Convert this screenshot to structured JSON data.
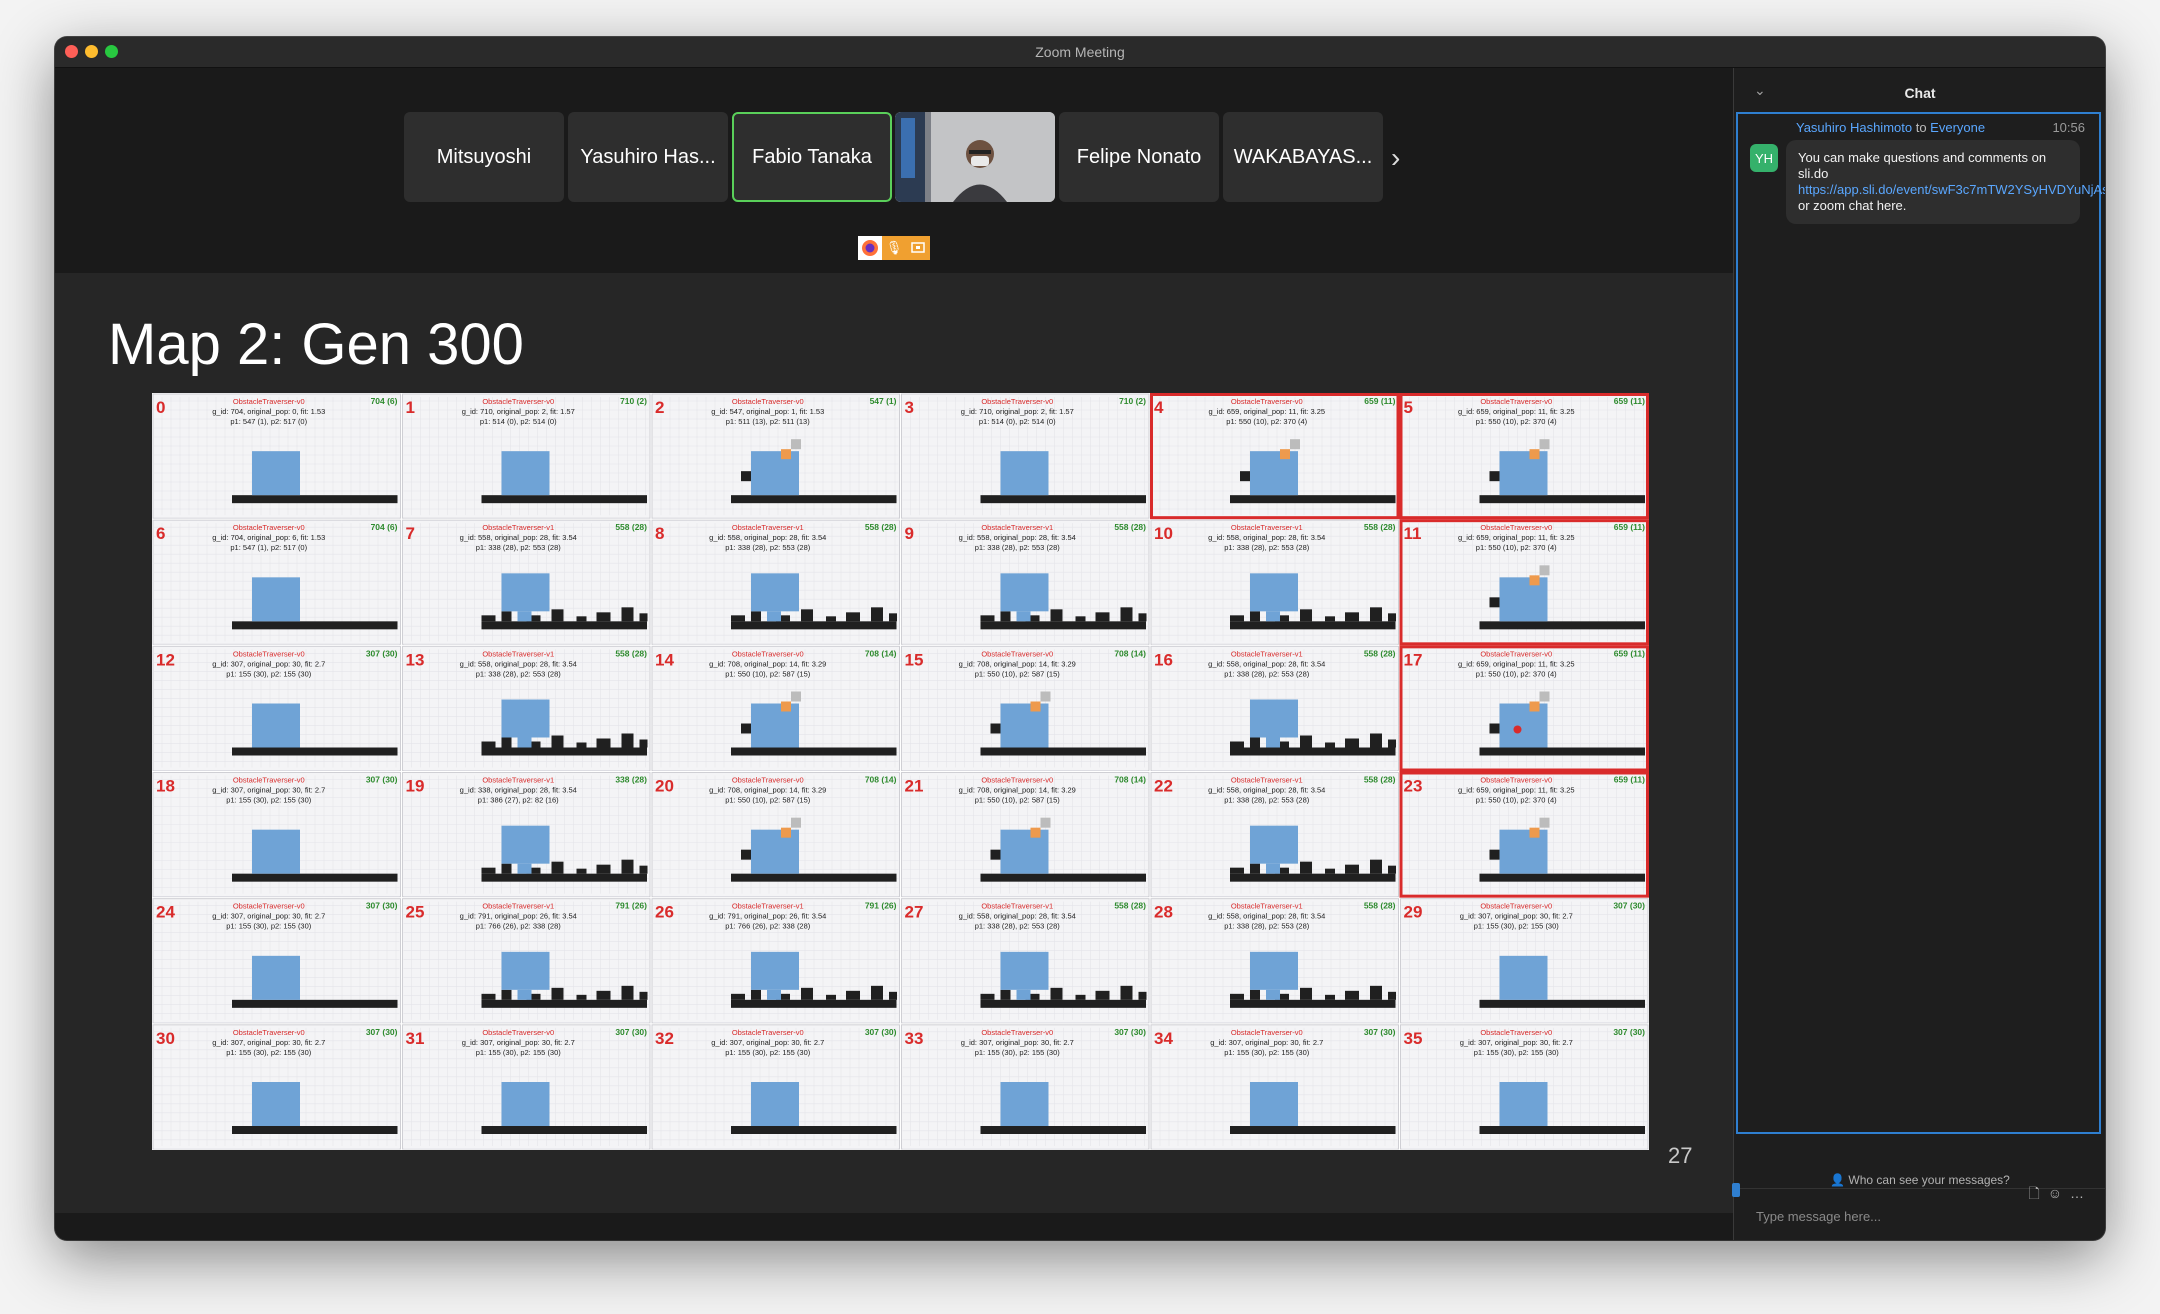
{
  "window": {
    "title": "Zoom Meeting"
  },
  "participants": [
    {
      "name": "Mitsuyoshi"
    },
    {
      "name": "Yasuhiro Has..."
    },
    {
      "name": "Fabio Tanaka",
      "active": true
    },
    {
      "name": "",
      "video": true
    },
    {
      "name": "Felipe Nonato"
    },
    {
      "name": "WAKABAYAS..."
    }
  ],
  "slide": {
    "title": "Map 2: Gen 300",
    "page_number": "27"
  },
  "grid": {
    "env_names": [
      "ObstacleTraverser-v0",
      "ObstacleTraverser-v1"
    ],
    "highlight_color": "#d92b2b",
    "highlighted_cells": [
      4,
      5,
      11,
      17,
      23
    ],
    "cells": [
      {
        "n": "0",
        "env": 0,
        "tr": "704 (6)",
        "l1": "g_id: 704, original_pop: 0, fit: 1.53",
        "l2": "p1: 547 (1), p2: 517 (0)",
        "h": false
      },
      {
        "n": "1",
        "env": 0,
        "tr": "710 (2)",
        "l1": "g_id: 710, original_pop: 2, fit: 1.57",
        "l2": "p1: 514 (0), p2: 514 (0)",
        "h": false
      },
      {
        "n": "2",
        "env": 0,
        "tr": "547 (1)",
        "l1": "g_id: 547, original_pop: 1, fit: 1.53",
        "l2": "p1: 511 (13), p2: 511 (13)",
        "h": false
      },
      {
        "n": "3",
        "env": 0,
        "tr": "710 (2)",
        "l1": "g_id: 710, original_pop: 2, fit: 1.57",
        "l2": "p1: 514 (0), p2: 514 (0)",
        "h": false
      },
      {
        "n": "4",
        "env": 0,
        "tr": "659 (11)",
        "l1": "g_id: 659, original_pop: 11, fit: 3.25",
        "l2": "p1: 550 (10), p2: 370 (4)",
        "h": false
      },
      {
        "n": "5",
        "env": 0,
        "tr": "659 (11)",
        "l1": "g_id: 659, original_pop: 11, fit: 3.25",
        "l2": "p1: 550 (10), p2: 370 (4)",
        "h": false
      },
      {
        "n": "6",
        "env": 0,
        "tr": "704 (6)",
        "l1": "g_id: 704, original_pop: 6, fit: 1.53",
        "l2": "p1: 547 (1), p2: 517 (0)",
        "h": false
      },
      {
        "n": "7",
        "env": 1,
        "tr": "558 (28)",
        "l1": "g_id: 558, original_pop: 28, fit: 3.54",
        "l2": "p1: 338 (28), p2: 553 (28)",
        "h": true
      },
      {
        "n": "8",
        "env": 1,
        "tr": "558 (28)",
        "l1": "g_id: 558, original_pop: 28, fit: 3.54",
        "l2": "p1: 338 (28), p2: 553 (28)",
        "h": true
      },
      {
        "n": "9",
        "env": 1,
        "tr": "558 (28)",
        "l1": "g_id: 558, original_pop: 28, fit: 3.54",
        "l2": "p1: 338 (28), p2: 553 (28)",
        "h": true
      },
      {
        "n": "10",
        "env": 1,
        "tr": "558 (28)",
        "l1": "g_id: 558, original_pop: 28, fit: 3.54",
        "l2": "p1: 338 (28), p2: 553 (28)",
        "h": true
      },
      {
        "n": "11",
        "env": 0,
        "tr": "659 (11)",
        "l1": "g_id: 659, original_pop: 11, fit: 3.25",
        "l2": "p1: 550 (10), p2: 370 (4)",
        "h": false
      },
      {
        "n": "12",
        "env": 0,
        "tr": "307 (30)",
        "l1": "g_id: 307, original_pop: 30, fit: 2.7",
        "l2": "p1: 155 (30), p2: 155 (30)",
        "h": false
      },
      {
        "n": "13",
        "env": 1,
        "tr": "558 (28)",
        "l1": "g_id: 558, original_pop: 28, fit: 3.54",
        "l2": "p1: 338 (28), p2: 553 (28)",
        "h": true
      },
      {
        "n": "14",
        "env": 0,
        "tr": "708 (14)",
        "l1": "g_id: 708, original_pop: 14, fit: 3.29",
        "l2": "p1: 550 (10), p2: 587 (15)",
        "h": false
      },
      {
        "n": "15",
        "env": 0,
        "tr": "708 (14)",
        "l1": "g_id: 708, original_pop: 14, fit: 3.29",
        "l2": "p1: 550 (10), p2: 587 (15)",
        "h": false
      },
      {
        "n": "16",
        "env": 1,
        "tr": "558 (28)",
        "l1": "g_id: 558, original_pop: 28, fit: 3.54",
        "l2": "p1: 338 (28), p2: 553 (28)",
        "h": true
      },
      {
        "n": "17",
        "env": 0,
        "tr": "659 (11)",
        "l1": "g_id: 659, original_pop: 11, fit: 3.25",
        "l2": "p1: 550 (10), p2: 370 (4)",
        "h": false
      },
      {
        "n": "18",
        "env": 0,
        "tr": "307 (30)",
        "l1": "g_id: 307, original_pop: 30, fit: 2.7",
        "l2": "p1: 155 (30), p2: 155 (30)",
        "h": false
      },
      {
        "n": "19",
        "env": 1,
        "tr": "338 (28)",
        "l1": "g_id: 338, original_pop: 28, fit: 3.54",
        "l2": "p1: 386 (27), p2: 82 (16)",
        "h": true
      },
      {
        "n": "20",
        "env": 0,
        "tr": "708 (14)",
        "l1": "g_id: 708, original_pop: 14, fit: 3.29",
        "l2": "p1: 550 (10), p2: 587 (15)",
        "h": false
      },
      {
        "n": "21",
        "env": 0,
        "tr": "708 (14)",
        "l1": "g_id: 708, original_pop: 14, fit: 3.29",
        "l2": "p1: 550 (10), p2: 587 (15)",
        "h": false
      },
      {
        "n": "22",
        "env": 1,
        "tr": "558 (28)",
        "l1": "g_id: 558, original_pop: 28, fit: 3.54",
        "l2": "p1: 338 (28), p2: 553 (28)",
        "h": true
      },
      {
        "n": "23",
        "env": 0,
        "tr": "659 (11)",
        "l1": "g_id: 659, original_pop: 11, fit: 3.25",
        "l2": "p1: 550 (10), p2: 370 (4)",
        "h": false
      },
      {
        "n": "24",
        "env": 0,
        "tr": "307 (30)",
        "l1": "g_id: 307, original_pop: 30, fit: 2.7",
        "l2": "p1: 155 (30), p2: 155 (30)",
        "h": false
      },
      {
        "n": "25",
        "env": 1,
        "tr": "791 (26)",
        "l1": "g_id: 791, original_pop: 26, fit: 3.54",
        "l2": "p1: 766 (26), p2: 338 (28)",
        "h": true
      },
      {
        "n": "26",
        "env": 1,
        "tr": "791 (26)",
        "l1": "g_id: 791, original_pop: 26, fit: 3.54",
        "l2": "p1: 766 (26), p2: 338 (28)",
        "h": true
      },
      {
        "n": "27",
        "env": 1,
        "tr": "558 (28)",
        "l1": "g_id: 558, original_pop: 28, fit: 3.54",
        "l2": "p1: 338 (28), p2: 553 (28)",
        "h": true
      },
      {
        "n": "28",
        "env": 1,
        "tr": "558 (28)",
        "l1": "g_id: 558, original_pop: 28, fit: 3.54",
        "l2": "p1: 338 (28), p2: 553 (28)",
        "h": true
      },
      {
        "n": "29",
        "env": 0,
        "tr": "307 (30)",
        "l1": "g_id: 307, original_pop: 30, fit: 2.7",
        "l2": "p1: 155 (30), p2: 155 (30)",
        "h": false
      },
      {
        "n": "30",
        "env": 0,
        "tr": "307 (30)",
        "l1": "g_id: 307, original_pop: 30, fit: 2.7",
        "l2": "p1: 155 (30), p2: 155 (30)",
        "h": false
      },
      {
        "n": "31",
        "env": 0,
        "tr": "307 (30)",
        "l1": "g_id: 307, original_pop: 30, fit: 2.7",
        "l2": "p1: 155 (30), p2: 155 (30)",
        "h": false
      },
      {
        "n": "32",
        "env": 0,
        "tr": "307 (30)",
        "l1": "g_id: 307, original_pop: 30, fit: 2.7",
        "l2": "p1: 155 (30), p2: 155 (30)",
        "h": false
      },
      {
        "n": "33",
        "env": 0,
        "tr": "307 (30)",
        "l1": "g_id: 307, original_pop: 30, fit: 2.7",
        "l2": "p1: 155 (30), p2: 155 (30)",
        "h": false
      },
      {
        "n": "34",
        "env": 0,
        "tr": "307 (30)",
        "l1": "g_id: 307, original_pop: 30, fit: 2.7",
        "l2": "p1: 155 (30), p2: 155 (30)",
        "h": false
      },
      {
        "n": "35",
        "env": 0,
        "tr": "307 (30)",
        "l1": "g_id: 307, original_pop: 30, fit: 2.7",
        "l2": "p1: 155 (30), p2: 155 (30)",
        "h": false
      }
    ]
  },
  "chat": {
    "title": "Chat",
    "message": {
      "sender": "Yasuhiro Hashimoto",
      "to_word": " to ",
      "recipient": "Everyone",
      "time": "10:56",
      "avatar_initials": "YH",
      "text_before": "You can make questions and comments on sli.do ",
      "link": "https://app.sli.do/event/swF3c7mTW2YSyHVDYuNjAs",
      "text_after": " or zoom chat here."
    },
    "who_can_see": "Who can see your messages?",
    "input_placeholder": "Type message here..."
  }
}
